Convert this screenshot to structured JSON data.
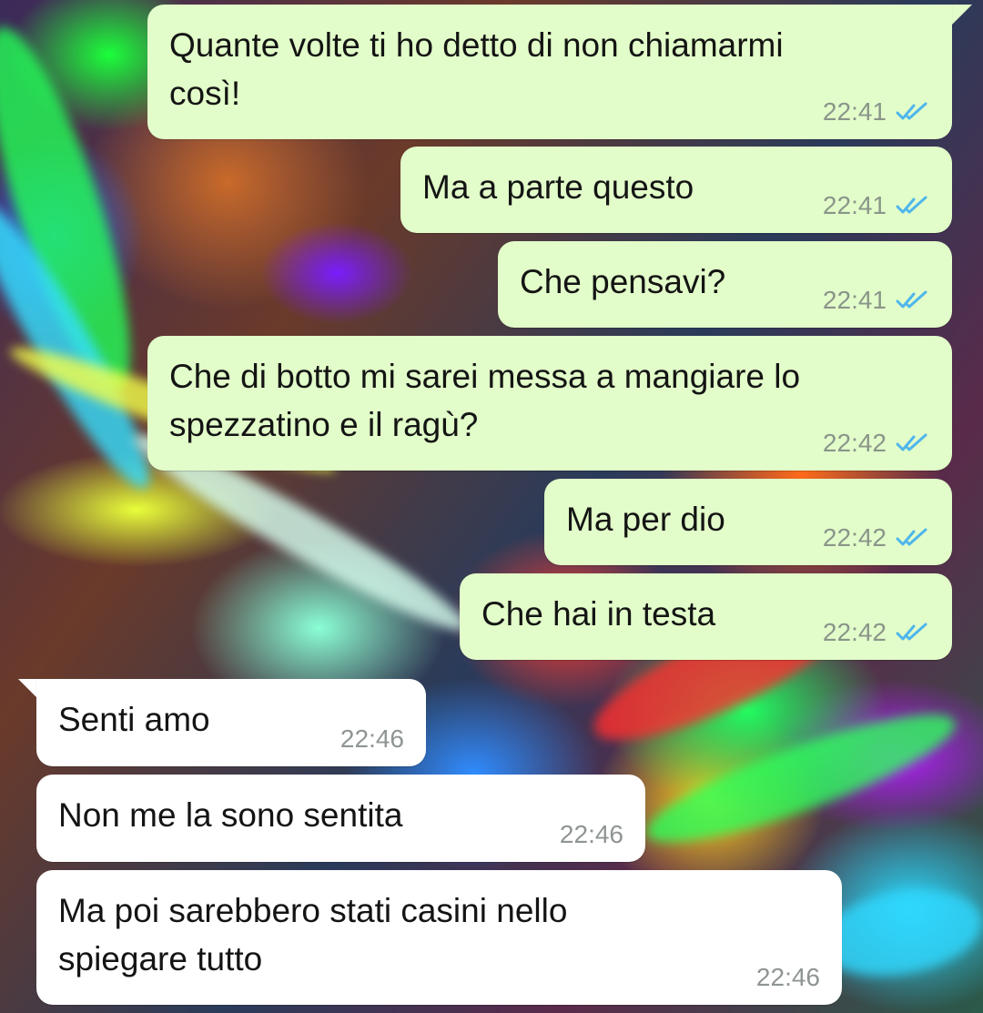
{
  "conversation": {
    "messages": [
      {
        "direction": "outgoing",
        "text": "Quante volte ti ho detto di non chiamarmi\ncosì!",
        "time": "22:41",
        "status": "read"
      },
      {
        "direction": "outgoing",
        "text": "Ma a parte questo",
        "time": "22:41",
        "status": "read"
      },
      {
        "direction": "outgoing",
        "text": "Che pensavi?",
        "time": "22:41",
        "status": "read"
      },
      {
        "direction": "outgoing",
        "text": "Che di botto mi sarei messa a mangiare lo\nspezzatino e il ragù?",
        "time": "22:42",
        "status": "read"
      },
      {
        "direction": "outgoing",
        "text": "Ma per dio",
        "time": "22:42",
        "status": "read"
      },
      {
        "direction": "outgoing",
        "text": "Che hai in testa",
        "time": "22:42",
        "status": "read"
      },
      {
        "direction": "incoming",
        "text": "Senti amo",
        "time": "22:46"
      },
      {
        "direction": "incoming",
        "text": "Non me la sono sentita",
        "time": "22:46"
      },
      {
        "direction": "incoming",
        "text": "Ma poi sarebbero stati casini nello\nspiegare tutto",
        "time": "22:46"
      }
    ]
  },
  "colors": {
    "outgoing_bubble": "#e2fdc9",
    "incoming_bubble": "#ffffff",
    "read_ticks": "#4fb6ec"
  },
  "icons": {
    "read_receipt": "double-check-icon"
  }
}
